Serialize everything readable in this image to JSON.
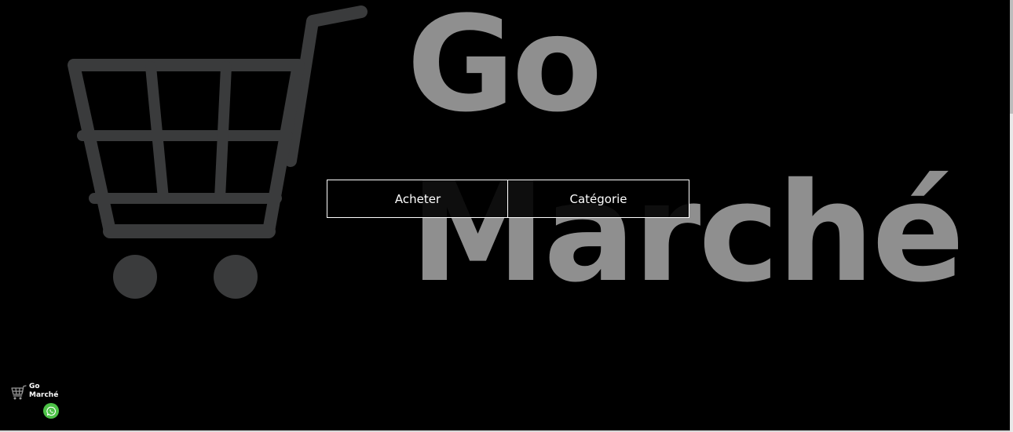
{
  "hero": {
    "title_line1": "Go",
    "title_line2": "Marché",
    "cart_icon": "shopping-cart-icon",
    "text_color": "#8f8f8f",
    "cart_color": "#3a3b3c"
  },
  "actions": {
    "buy_label": "Acheter",
    "category_label": "Catégorie"
  },
  "footer_logo": {
    "line1": "Go",
    "line2": "Marché",
    "icon": "shopping-cart-icon"
  },
  "whatsapp": {
    "icon": "whatsapp-icon",
    "color": "#4dc247"
  }
}
